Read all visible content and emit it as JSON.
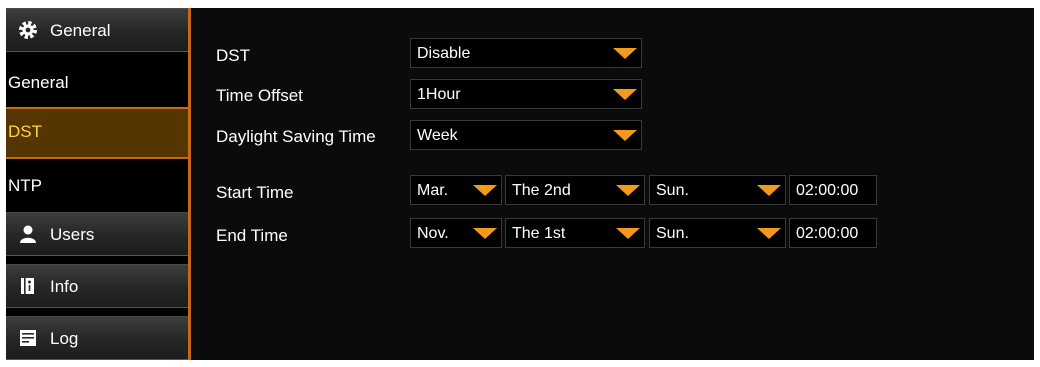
{
  "sidebar": {
    "sections": [
      {
        "label": "General",
        "icon": "gear-icon"
      },
      {
        "label": "Users",
        "icon": "user-icon"
      },
      {
        "label": "Info",
        "icon": "info-book-icon"
      },
      {
        "label": "Log",
        "icon": "log-icon"
      }
    ],
    "sub_items": [
      {
        "label": "General"
      },
      {
        "label": "DST"
      },
      {
        "label": "NTP"
      }
    ],
    "accent_color": "#c56a12",
    "active_text_color": "#ffd24a"
  },
  "form": {
    "dst": {
      "label": "DST",
      "value": "Disable"
    },
    "time_offset": {
      "label": "Time Offset",
      "value": "1Hour"
    },
    "daylight_saving_time": {
      "label": "Daylight Saving Time",
      "value": "Week"
    },
    "start_time": {
      "label": "Start Time",
      "month": "Mar.",
      "week": "The 2nd",
      "day": "Sun.",
      "time": "02:00:00"
    },
    "end_time": {
      "label": "End Time",
      "month": "Nov.",
      "week": "The 1st",
      "day": "Sun.",
      "time": "02:00:00"
    }
  },
  "colors": {
    "dropdown_arrow": "#f39a1d",
    "background": "#0b0b0b"
  }
}
